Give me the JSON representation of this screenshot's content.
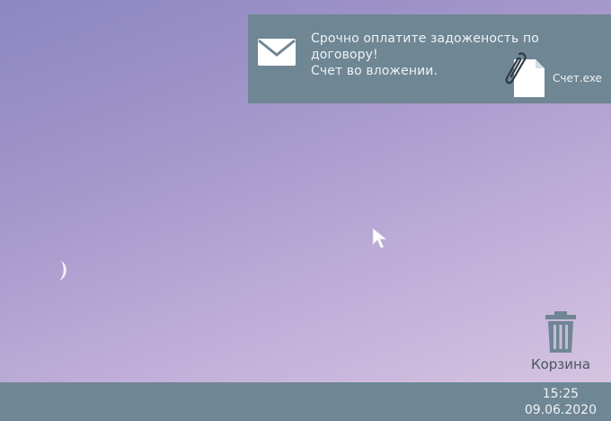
{
  "notification": {
    "icon": "envelope-icon",
    "message_lines": [
      "Срочно оплатите задоженость по",
      "договору!",
      "Счет во вложении."
    ],
    "attachment": {
      "icon": "paperclip-document-icon",
      "filename": "Счет.exe"
    }
  },
  "desktop": {
    "trash": {
      "icon": "trash-icon",
      "label": "Корзина"
    },
    "moon_icon": "crescent-moon-icon",
    "cursor_icon": "mouse-cursor-icon"
  },
  "taskbar": {
    "time": "15:25",
    "date": "09.06.2020"
  },
  "colors": {
    "panel": "#6f8694",
    "text_light": "#eef2f5"
  }
}
